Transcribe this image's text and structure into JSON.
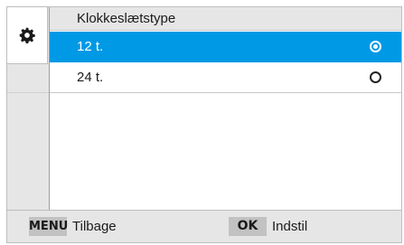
{
  "sidebar": {
    "icon": "gear-icon"
  },
  "menu": {
    "title": "Klokkeslætstype",
    "options": [
      {
        "label": "12 t.",
        "selected": true
      },
      {
        "label": "24 t.",
        "selected": false
      }
    ]
  },
  "footer": {
    "menu_key": "MENU",
    "back_label": "Tilbage",
    "ok_key": "OK",
    "set_label": "Indstil"
  },
  "colors": {
    "selection": "#0099e5",
    "panel": "#e6e6e6"
  }
}
